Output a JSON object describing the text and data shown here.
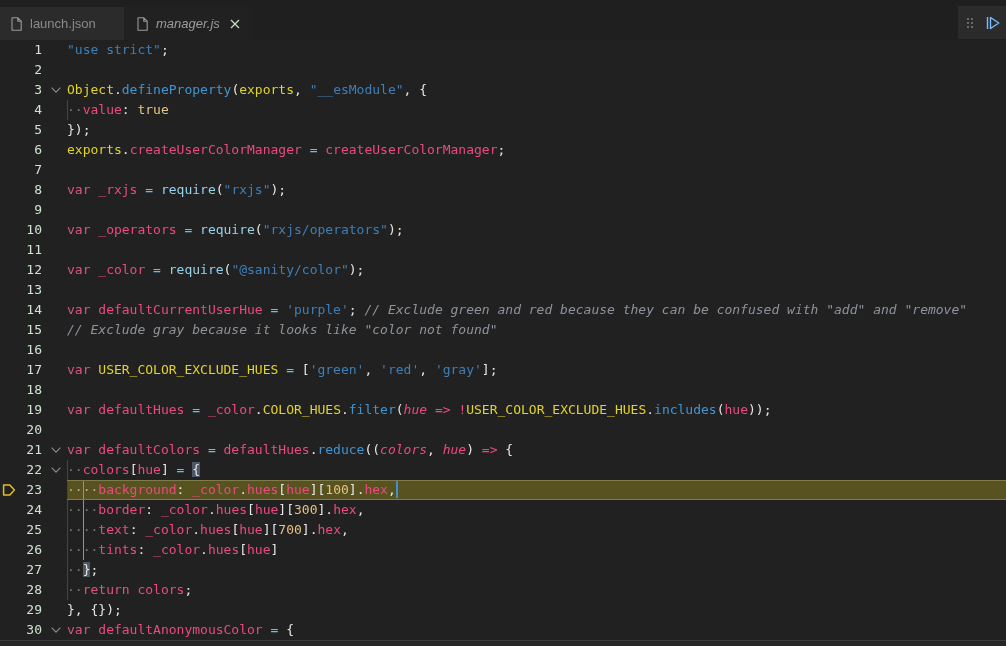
{
  "tabs": [
    {
      "label": "launch.json",
      "selected": false,
      "preview": false
    },
    {
      "label": "manager.js",
      "selected": true,
      "preview": true
    }
  ],
  "lines": [
    {
      "number": "1",
      "current": false,
      "cursor": false,
      "tokens": [
        {
          "text": "\"use strict\"",
          "kind": "string"
        },
        {
          "text": ";",
          "kind": "punctuation"
        }
      ]
    },
    {
      "number": "2",
      "current": false,
      "cursor": false
    },
    {
      "number": "3",
      "current": false,
      "cursor": false,
      "expanded": true,
      "tokens": [
        {
          "text": "Object",
          "kind": "object"
        },
        {
          "text": ".",
          "kind": "punctuation"
        },
        {
          "text": "defineProperty",
          "kind": "method"
        },
        {
          "text": "(",
          "kind": "punctuation"
        },
        {
          "text": "exports",
          "kind": "object"
        },
        {
          "text": ", ",
          "kind": "punctuation"
        },
        {
          "text": "\"__esModule\"",
          "kind": "string"
        },
        {
          "text": ", {",
          "kind": "punctuation"
        }
      ]
    },
    {
      "number": "4",
      "current": false,
      "cursor": false,
      "tokens": [
        {
          "text": "··",
          "kind": "indent"
        },
        {
          "text": "value",
          "kind": "identifier"
        },
        {
          "text": ": ",
          "kind": "punctuation"
        },
        {
          "text": "true",
          "kind": "literal"
        }
      ]
    },
    {
      "number": "5",
      "current": false,
      "cursor": false,
      "tokens": [
        {
          "text": "});",
          "kind": "punctuation"
        }
      ]
    },
    {
      "number": "6",
      "current": false,
      "cursor": false,
      "tokens": [
        {
          "text": "exports",
          "kind": "object"
        },
        {
          "text": ".",
          "kind": "punctuation"
        },
        {
          "text": "createUserColorManager",
          "kind": "identifier"
        },
        {
          "text": " = ",
          "kind": "operator"
        },
        {
          "text": "createUserColorManager",
          "kind": "identifier"
        },
        {
          "text": ";",
          "kind": "punctuation"
        }
      ]
    },
    {
      "number": "7",
      "current": false,
      "cursor": false
    },
    {
      "number": "8",
      "current": false,
      "cursor": false,
      "tokens": [
        {
          "text": "var",
          "kind": "keyword"
        },
        {
          "text": " _rxjs",
          "kind": "identifier"
        },
        {
          "text": " = ",
          "kind": "operator"
        },
        {
          "text": "require",
          "kind": "call"
        },
        {
          "text": "(",
          "kind": "punctuation"
        },
        {
          "text": "\"rxjs\"",
          "kind": "string"
        },
        {
          "text": ");",
          "kind": "punctuation"
        }
      ]
    },
    {
      "number": "9",
      "current": false,
      "cursor": false
    },
    {
      "number": "10",
      "current": false,
      "cursor": false,
      "tokens": [
        {
          "text": "var",
          "kind": "keyword"
        },
        {
          "text": " _operators",
          "kind": "identifier"
        },
        {
          "text": " = ",
          "kind": "operator"
        },
        {
          "text": "require",
          "kind": "call"
        },
        {
          "text": "(",
          "kind": "punctuation"
        },
        {
          "text": "\"rxjs/operators\"",
          "kind": "string"
        },
        {
          "text": ");",
          "kind": "punctuation"
        }
      ]
    },
    {
      "number": "11",
      "current": false,
      "cursor": false
    },
    {
      "number": "12",
      "current": false,
      "cursor": false,
      "tokens": [
        {
          "text": "var",
          "kind": "keyword"
        },
        {
          "text": " _color",
          "kind": "identifier"
        },
        {
          "text": " = ",
          "kind": "operator"
        },
        {
          "text": "require",
          "kind": "call"
        },
        {
          "text": "(",
          "kind": "punctuation"
        },
        {
          "text": "\"@sanity/color\"",
          "kind": "string"
        },
        {
          "text": ");",
          "kind": "punctuation"
        }
      ]
    },
    {
      "number": "13",
      "current": false,
      "cursor": false
    },
    {
      "number": "14",
      "current": false,
      "cursor": false,
      "tokens": [
        {
          "text": "var",
          "kind": "keyword"
        },
        {
          "text": " defaultCurrentUserHue",
          "kind": "identifier"
        },
        {
          "text": " = ",
          "kind": "operator"
        },
        {
          "text": "'purple'",
          "kind": "string"
        },
        {
          "text": "; ",
          "kind": "punctuation"
        },
        {
          "text": "// Exclude green and red because they can be confused with \"add\" and \"remove\"",
          "kind": "comment"
        }
      ]
    },
    {
      "number": "15",
      "current": false,
      "cursor": false,
      "tokens": [
        {
          "text": "// Exclude gray because it looks like \"color not found\"",
          "kind": "comment"
        }
      ]
    },
    {
      "number": "16",
      "current": false,
      "cursor": false
    },
    {
      "number": "17",
      "current": false,
      "cursor": false,
      "tokens": [
        {
          "text": "var",
          "kind": "keyword"
        },
        {
          "text": " USER_COLOR_EXCLUDE_HUES",
          "kind": "object"
        },
        {
          "text": " = ",
          "kind": "operator"
        },
        {
          "text": "[",
          "kind": "punctuation"
        },
        {
          "text": "'green'",
          "kind": "string"
        },
        {
          "text": ", ",
          "kind": "punctuation"
        },
        {
          "text": "'red'",
          "kind": "string"
        },
        {
          "text": ", ",
          "kind": "punctuation"
        },
        {
          "text": "'gray'",
          "kind": "string"
        },
        {
          "text": "];",
          "kind": "punctuation"
        }
      ]
    },
    {
      "number": "18",
      "current": false,
      "cursor": false
    },
    {
      "number": "19",
      "current": false,
      "cursor": false,
      "tokens": [
        {
          "text": "var",
          "kind": "keyword"
        },
        {
          "text": " defaultHues",
          "kind": "identifier"
        },
        {
          "text": " = ",
          "kind": "operator"
        },
        {
          "text": "_color",
          "kind": "identifier"
        },
        {
          "text": ".",
          "kind": "punctuation"
        },
        {
          "text": "COLOR_HUES",
          "kind": "object"
        },
        {
          "text": ".",
          "kind": "punctuation"
        },
        {
          "text": "filter",
          "kind": "method"
        },
        {
          "text": "(",
          "kind": "punctuation"
        },
        {
          "text": "hue",
          "kind": "param"
        },
        {
          "text": " => !",
          "kind": "arrow"
        },
        {
          "text": "USER_COLOR_EXCLUDE_HUES",
          "kind": "object"
        },
        {
          "text": ".",
          "kind": "punctuation"
        },
        {
          "text": "includes",
          "kind": "method"
        },
        {
          "text": "(",
          "kind": "punctuation"
        },
        {
          "text": "hue",
          "kind": "identifier"
        },
        {
          "text": "));",
          "kind": "punctuation"
        }
      ]
    },
    {
      "number": "20",
      "current": false,
      "cursor": false
    },
    {
      "number": "21",
      "current": false,
      "cursor": false,
      "expanded": true,
      "tokens": [
        {
          "text": "var",
          "kind": "keyword"
        },
        {
          "text": " defaultColors",
          "kind": "identifier"
        },
        {
          "text": " = ",
          "kind": "operator"
        },
        {
          "text": "defaultHues",
          "kind": "identifier"
        },
        {
          "text": ".",
          "kind": "punctuation"
        },
        {
          "text": "reduce",
          "kind": "method"
        },
        {
          "text": "((",
          "kind": "punctuation"
        },
        {
          "text": "colors",
          "kind": "param"
        },
        {
          "text": ", ",
          "kind": "punctuation"
        },
        {
          "text": "hue",
          "kind": "param"
        },
        {
          "text": ") ",
          "kind": "punctuation"
        },
        {
          "text": "=>",
          "kind": "arrow"
        },
        {
          "text": " {",
          "kind": "punctuation"
        }
      ]
    },
    {
      "number": "22",
      "current": false,
      "cursor": false,
      "expanded": true,
      "tokens": [
        {
          "text": "··",
          "kind": "indent"
        },
        {
          "text": "colors",
          "kind": "identifier"
        },
        {
          "text": "[",
          "kind": "punctuation"
        },
        {
          "text": "hue",
          "kind": "identifier"
        },
        {
          "text": "]",
          "kind": "punctuation"
        },
        {
          "text": " = ",
          "kind": "operator"
        },
        {
          "text": "{",
          "kind": "punctuation",
          "match": true
        }
      ]
    },
    {
      "number": "23",
      "current": true,
      "cursor": true,
      "tokens": [
        {
          "text": "··",
          "kind": "indent"
        },
        {
          "text": "··",
          "kind": "indent-active"
        },
        {
          "text": "background",
          "kind": "identifier"
        },
        {
          "text": ": ",
          "kind": "punctuation"
        },
        {
          "text": "_color",
          "kind": "identifier"
        },
        {
          "text": ".",
          "kind": "punctuation"
        },
        {
          "text": "hues",
          "kind": "identifier"
        },
        {
          "text": "[",
          "kind": "punctuation"
        },
        {
          "text": "hue",
          "kind": "identifier"
        },
        {
          "text": "][",
          "kind": "punctuation"
        },
        {
          "text": "100",
          "kind": "literal"
        },
        {
          "text": "].",
          "kind": "punctuation"
        },
        {
          "text": "hex",
          "kind": "identifier"
        },
        {
          "text": ",",
          "kind": "punctuation"
        }
      ]
    },
    {
      "number": "24",
      "current": false,
      "cursor": false,
      "tokens": [
        {
          "text": "··",
          "kind": "indent"
        },
        {
          "text": "··",
          "kind": "indent-active"
        },
        {
          "text": "border",
          "kind": "identifier"
        },
        {
          "text": ": ",
          "kind": "punctuation"
        },
        {
          "text": "_color",
          "kind": "identifier"
        },
        {
          "text": ".",
          "kind": "punctuation"
        },
        {
          "text": "hues",
          "kind": "identifier"
        },
        {
          "text": "[",
          "kind": "punctuation"
        },
        {
          "text": "hue",
          "kind": "identifier"
        },
        {
          "text": "][",
          "kind": "punctuation"
        },
        {
          "text": "300",
          "kind": "literal"
        },
        {
          "text": "].",
          "kind": "punctuation"
        },
        {
          "text": "hex",
          "kind": "identifier"
        },
        {
          "text": ",",
          "kind": "punctuation"
        }
      ]
    },
    {
      "number": "25",
      "current": false,
      "cursor": false,
      "tokens": [
        {
          "text": "··",
          "kind": "indent"
        },
        {
          "text": "··",
          "kind": "indent-active"
        },
        {
          "text": "text",
          "kind": "identifier"
        },
        {
          "text": ": ",
          "kind": "punctuation"
        },
        {
          "text": "_color",
          "kind": "identifier"
        },
        {
          "text": ".",
          "kind": "punctuation"
        },
        {
          "text": "hues",
          "kind": "identifier"
        },
        {
          "text": "[",
          "kind": "punctuation"
        },
        {
          "text": "hue",
          "kind": "identifier"
        },
        {
          "text": "][",
          "kind": "punctuation"
        },
        {
          "text": "700",
          "kind": "literal"
        },
        {
          "text": "].",
          "kind": "punctuation"
        },
        {
          "text": "hex",
          "kind": "identifier"
        },
        {
          "text": ",",
          "kind": "punctuation"
        }
      ]
    },
    {
      "number": "26",
      "current": false,
      "cursor": false,
      "tokens": [
        {
          "text": "··",
          "kind": "indent"
        },
        {
          "text": "··",
          "kind": "indent-active"
        },
        {
          "text": "tints",
          "kind": "identifier"
        },
        {
          "text": ": ",
          "kind": "punctuation"
        },
        {
          "text": "_color",
          "kind": "identifier"
        },
        {
          "text": ".",
          "kind": "punctuation"
        },
        {
          "text": "hues",
          "kind": "identifier"
        },
        {
          "text": "[",
          "kind": "punctuation"
        },
        {
          "text": "hue",
          "kind": "identifier"
        },
        {
          "text": "]",
          "kind": "punctuation"
        }
      ]
    },
    {
      "number": "27",
      "current": false,
      "cursor": false,
      "tokens": [
        {
          "text": "··",
          "kind": "indent"
        },
        {
          "text": "}",
          "kind": "punctuation",
          "match": true
        },
        {
          "text": ";",
          "kind": "punctuation"
        }
      ]
    },
    {
      "number": "28",
      "current": false,
      "cursor": false,
      "tokens": [
        {
          "text": "··",
          "kind": "indent"
        },
        {
          "text": "return",
          "kind": "keyword"
        },
        {
          "text": " colors",
          "kind": "identifier"
        },
        {
          "text": ";",
          "kind": "punctuation"
        }
      ]
    },
    {
      "number": "29",
      "current": false,
      "cursor": false,
      "tokens": [
        {
          "text": "}, {});",
          "kind": "punctuation"
        }
      ]
    },
    {
      "number": "30",
      "current": false,
      "cursor": false,
      "expanded": true,
      "tokens": [
        {
          "text": "var",
          "kind": "keyword"
        },
        {
          "text": " defaultAnonymousColor",
          "kind": "identifier"
        },
        {
          "text": " = ",
          "kind": "operator"
        },
        {
          "text": "{",
          "kind": "punctuation"
        }
      ]
    }
  ]
}
